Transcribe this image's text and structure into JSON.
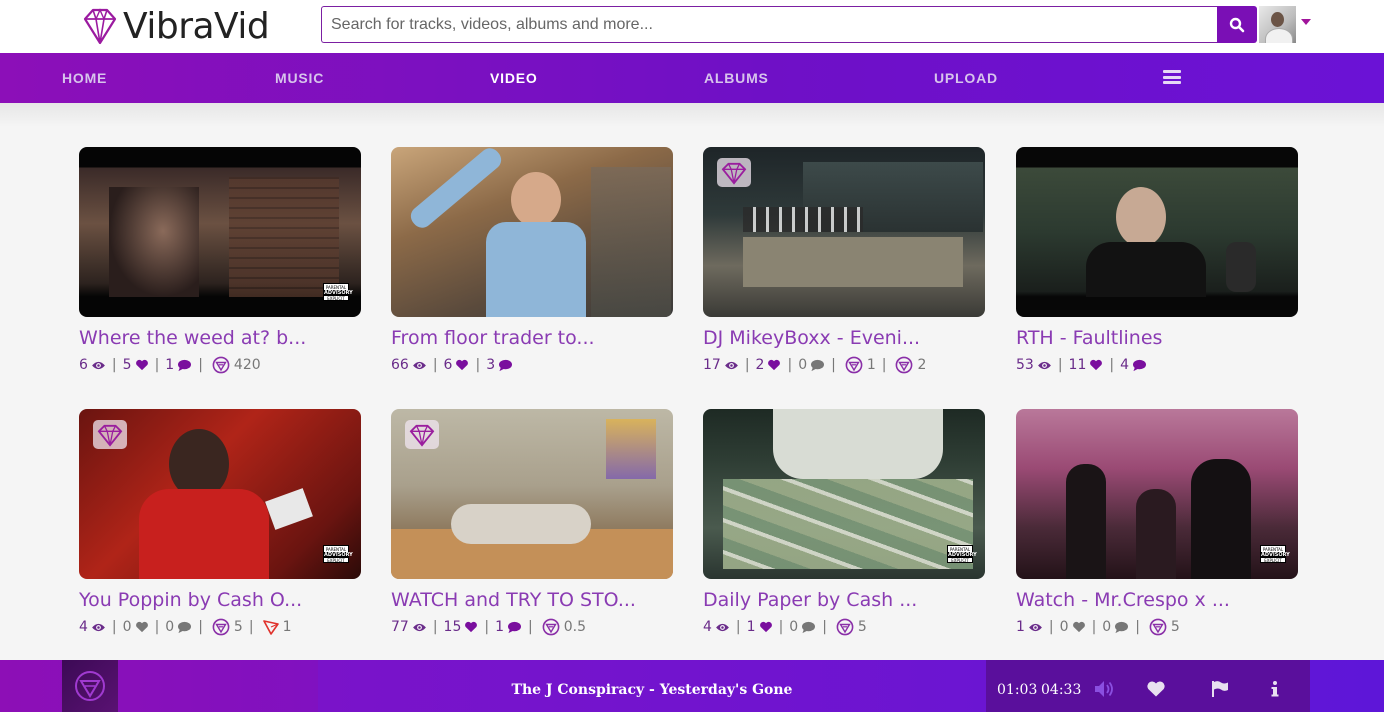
{
  "app": {
    "logo_text": "VibraVid"
  },
  "search": {
    "placeholder": "Search for tracks, videos, albums and more..."
  },
  "nav": {
    "items": [
      {
        "label": "HOME"
      },
      {
        "label": "MUSIC"
      },
      {
        "label": "VIDEO",
        "active": true
      },
      {
        "label": "ALBUMS"
      },
      {
        "label": "UPLOAD"
      }
    ]
  },
  "colors": {
    "brand": "#7a0fb5",
    "accent_text": "#8a3bb3",
    "nav_start": "#8c0fb8",
    "nav_end": "#6b12d6"
  },
  "videos": [
    {
      "title": "Where the weed at? b...",
      "views": "6",
      "likes": "5",
      "comments": "1",
      "tips": "420",
      "tip_icon": "vibra-token-icon"
    },
    {
      "title": "From floor trader to...",
      "views": "66",
      "likes": "6",
      "comments": "3"
    },
    {
      "title": "DJ MikeyBoxx - Eveni...",
      "views": "17",
      "likes": "2",
      "comments": "0",
      "tips": "1",
      "tips2": "2",
      "badge": "diamond-badge-icon"
    },
    {
      "title": "RTH - Faultlines",
      "views": "53",
      "likes": "11",
      "comments": "4"
    },
    {
      "title": "You Poppin by Cash O...",
      "views": "4",
      "likes": "0",
      "comments": "0",
      "tips": "5",
      "tips2": "1",
      "tip2_icon": "tron-icon",
      "badge": "diamond-badge-icon"
    },
    {
      "title": "WATCH and TRY TO STO...",
      "views": "77",
      "likes": "15",
      "comments": "1",
      "tips": "0.5",
      "badge": "diamond-badge-icon"
    },
    {
      "title": "Daily Paper by Cash ...",
      "views": "4",
      "likes": "1",
      "comments": "0",
      "tips": "5"
    },
    {
      "title": "Watch - Mr.Crespo x ...",
      "views": "1",
      "likes": "0",
      "comments": "0",
      "tips": "5"
    }
  ],
  "player": {
    "track_title": "The J Conspiracy  -  Yesterday's Gone",
    "current_time": "01:03",
    "duration": "04:33"
  }
}
